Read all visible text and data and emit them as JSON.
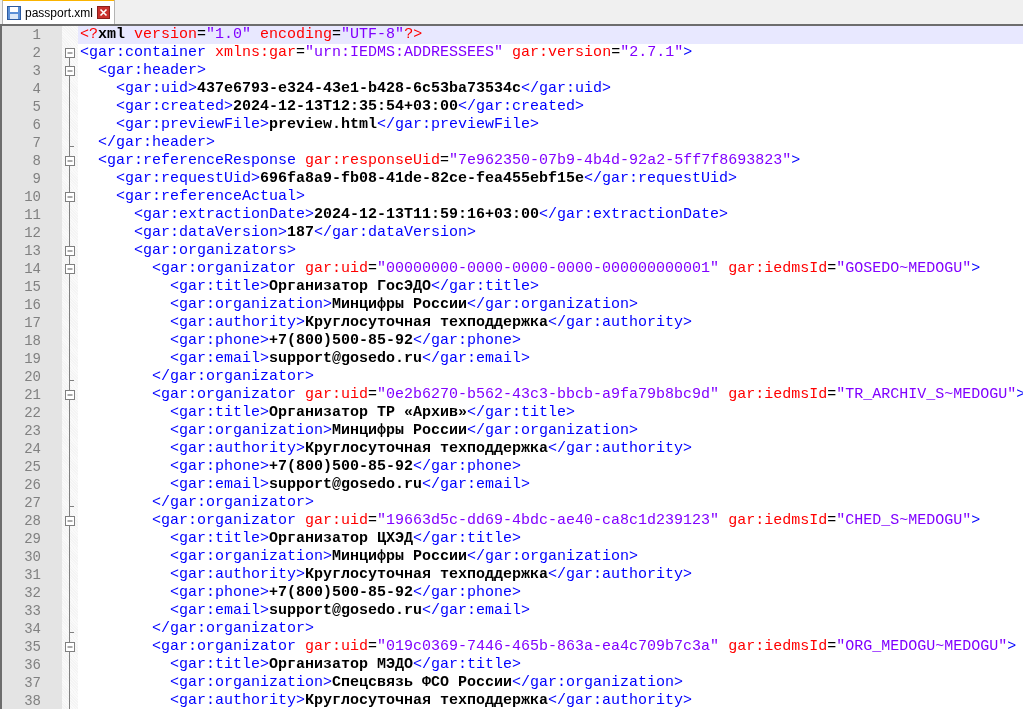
{
  "tabs": [
    {
      "label": "passport.xml",
      "selected": true
    }
  ],
  "lines": [
    {
      "number": "1",
      "kind": "plain",
      "current": true,
      "tokens": [
        {
          "kind": "pi",
          "text": "<?"
        },
        {
          "kind": "text",
          "text": "xml"
        },
        {
          "kind": "attr",
          "text": " version"
        },
        {
          "kind": "eq",
          "text": "="
        },
        {
          "kind": "value",
          "text": "\"1.0\""
        },
        {
          "kind": "attr",
          "text": " encoding"
        },
        {
          "kind": "eq",
          "text": "="
        },
        {
          "kind": "value",
          "text": "\"UTF-8\""
        },
        {
          "kind": "pi",
          "text": "?>"
        }
      ]
    },
    {
      "number": "2",
      "kind": "fold_start",
      "current": false,
      "tokens": [
        {
          "kind": "tag",
          "text": "<gar:container"
        },
        {
          "kind": "attr",
          "text": " xmlns:gar"
        },
        {
          "kind": "eq",
          "text": "="
        },
        {
          "kind": "value",
          "text": "\"urn:IEDMS:ADDRESSEES\""
        },
        {
          "kind": "attr",
          "text": " gar:version"
        },
        {
          "kind": "eq",
          "text": "="
        },
        {
          "kind": "value",
          "text": "\"2.7.1\""
        },
        {
          "kind": "tag",
          "text": ">"
        }
      ],
      "children": [
        {
          "number": "3",
          "kind": "fold_start",
          "current": false,
          "tokens": [
            {
              "kind": "tag",
              "text": "<gar:header>"
            }
          ],
          "children": [
            {
              "number": "4",
              "kind": "plain",
              "current": false,
              "tokens": [
                {
                  "kind": "tag",
                  "text": "<gar:uid>"
                },
                {
                  "kind": "text",
                  "text": "437e6793-e324-43e1-b428-6c53ba73534c"
                },
                {
                  "kind": "tag",
                  "text": "</gar:uid>"
                }
              ]
            },
            {
              "number": "5",
              "kind": "plain",
              "current": false,
              "tokens": [
                {
                  "kind": "tag",
                  "text": "<gar:created>"
                },
                {
                  "kind": "text",
                  "text": "2024-12-13T12:35:54+03:00"
                },
                {
                  "kind": "tag",
                  "text": "</gar:created>"
                }
              ]
            },
            {
              "number": "6",
              "kind": "plain",
              "current": false,
              "tokens": [
                {
                  "kind": "tag",
                  "text": "<gar:previewFile>"
                },
                {
                  "kind": "text",
                  "text": "preview.html"
                },
                {
                  "kind": "tag",
                  "text": "</gar:previewFile>"
                }
              ]
            }
          ]
        },
        {
          "number": "7",
          "kind": "fold_end",
          "current": false,
          "tokens": [
            {
              "kind": "tag",
              "text": "</gar:header>"
            }
          ]
        },
        {
          "number": "8",
          "kind": "fold_start",
          "current": false,
          "tokens": [
            {
              "kind": "tag",
              "text": "<gar:referenceResponse"
            },
            {
              "kind": "attr",
              "text": " gar:responseUid"
            },
            {
              "kind": "eq",
              "text": "="
            },
            {
              "kind": "value",
              "text": "\"7e962350-07b9-4b4d-92a2-5ff7f8693823\""
            },
            {
              "kind": "tag",
              "text": ">"
            }
          ],
          "children": [
            {
              "number": "9",
              "kind": "plain",
              "current": false,
              "tokens": [
                {
                  "kind": "tag",
                  "text": "<gar:requestUid>"
                },
                {
                  "kind": "text",
                  "text": "696fa8a9-fb08-41de-82ce-fea455ebf15e"
                },
                {
                  "kind": "tag",
                  "text": "</gar:requestUid>"
                }
              ]
            },
            {
              "number": "10",
              "kind": "fold_start",
              "current": false,
              "tokens": [
                {
                  "kind": "tag",
                  "text": "<gar:referenceActual>"
                }
              ],
              "children": [
                {
                  "number": "11",
                  "kind": "plain",
                  "current": false,
                  "tokens": [
                    {
                      "kind": "tag",
                      "text": "<gar:extractionDate>"
                    },
                    {
                      "kind": "text",
                      "text": "2024-12-13T11:59:16+03:00"
                    },
                    {
                      "kind": "tag",
                      "text": "</gar:extractionDate>"
                    }
                  ]
                },
                {
                  "number": "12",
                  "kind": "plain",
                  "current": false,
                  "tokens": [
                    {
                      "kind": "tag",
                      "text": "<gar:dataVersion>"
                    },
                    {
                      "kind": "text",
                      "text": "187"
                    },
                    {
                      "kind": "tag",
                      "text": "</gar:dataVersion>"
                    }
                  ]
                },
                {
                  "number": "13",
                  "kind": "fold_start",
                  "current": false,
                  "tokens": [
                    {
                      "kind": "tag",
                      "text": "<gar:organizators>"
                    }
                  ],
                  "children": [
                    {
                      "number": "14",
                      "kind": "fold_start",
                      "current": false,
                      "tokens": [
                        {
                          "kind": "tag",
                          "text": "<gar:organizator"
                        },
                        {
                          "kind": "attr",
                          "text": " gar:uid"
                        },
                        {
                          "kind": "eq",
                          "text": "="
                        },
                        {
                          "kind": "value",
                          "text": "\"00000000-0000-0000-0000-000000000001\""
                        },
                        {
                          "kind": "attr",
                          "text": " gar:iedmsId"
                        },
                        {
                          "kind": "eq",
                          "text": "="
                        },
                        {
                          "kind": "value",
                          "text": "\"GOSEDO~MEDOGU\""
                        },
                        {
                          "kind": "tag",
                          "text": ">"
                        }
                      ],
                      "children": [
                        {
                          "number": "15",
                          "kind": "plain",
                          "current": false,
                          "tokens": [
                            {
                              "kind": "tag",
                              "text": "<gar:title>"
                            },
                            {
                              "kind": "text",
                              "text": "Организатор ГосЭДО"
                            },
                            {
                              "kind": "tag",
                              "text": "</gar:title>"
                            }
                          ]
                        },
                        {
                          "number": "16",
                          "kind": "plain",
                          "current": false,
                          "tokens": [
                            {
                              "kind": "tag",
                              "text": "<gar:organization>"
                            },
                            {
                              "kind": "text",
                              "text": "Минцифры России"
                            },
                            {
                              "kind": "tag",
                              "text": "</gar:organization>"
                            }
                          ]
                        },
                        {
                          "number": "17",
                          "kind": "plain",
                          "current": false,
                          "tokens": [
                            {
                              "kind": "tag",
                              "text": "<gar:authority>"
                            },
                            {
                              "kind": "text",
                              "text": "Круглосуточная техподдержка"
                            },
                            {
                              "kind": "tag",
                              "text": "</gar:authority>"
                            }
                          ]
                        },
                        {
                          "number": "18",
                          "kind": "plain",
                          "current": false,
                          "tokens": [
                            {
                              "kind": "tag",
                              "text": "<gar:phone>"
                            },
                            {
                              "kind": "text",
                              "text": "+7(800)500-85-92"
                            },
                            {
                              "kind": "tag",
                              "text": "</gar:phone>"
                            }
                          ]
                        },
                        {
                          "number": "19",
                          "kind": "plain",
                          "current": false,
                          "tokens": [
                            {
                              "kind": "tag",
                              "text": "<gar:email>"
                            },
                            {
                              "kind": "text",
                              "text": "support@gosedo.ru"
                            },
                            {
                              "kind": "tag",
                              "text": "</gar:email>"
                            }
                          ]
                        }
                      ]
                    },
                    {
                      "number": "20",
                      "kind": "fold_end",
                      "current": false,
                      "tokens": [
                        {
                          "kind": "tag",
                          "text": "</gar:organizator>"
                        }
                      ]
                    },
                    {
                      "number": "21",
                      "kind": "fold_start",
                      "current": false,
                      "tokens": [
                        {
                          "kind": "tag",
                          "text": "<gar:organizator"
                        },
                        {
                          "kind": "attr",
                          "text": " gar:uid"
                        },
                        {
                          "kind": "eq",
                          "text": "="
                        },
                        {
                          "kind": "value",
                          "text": "\"0e2b6270-b562-43c3-bbcb-a9fa79b8bc9d\""
                        },
                        {
                          "kind": "attr",
                          "text": " gar:iedmsId"
                        },
                        {
                          "kind": "eq",
                          "text": "="
                        },
                        {
                          "kind": "value",
                          "text": "\"TR_ARCHIV_S~MEDOGU\""
                        },
                        {
                          "kind": "tag",
                          "text": ">"
                        }
                      ],
                      "children": [
                        {
                          "number": "22",
                          "kind": "plain",
                          "current": false,
                          "tokens": [
                            {
                              "kind": "tag",
                              "text": "<gar:title>"
                            },
                            {
                              "kind": "text",
                              "text": "Организатор ТР «Архив»"
                            },
                            {
                              "kind": "tag",
                              "text": "</gar:title>"
                            }
                          ]
                        },
                        {
                          "number": "23",
                          "kind": "plain",
                          "current": false,
                          "tokens": [
                            {
                              "kind": "tag",
                              "text": "<gar:organization>"
                            },
                            {
                              "kind": "text",
                              "text": "Минцифры России"
                            },
                            {
                              "kind": "tag",
                              "text": "</gar:organization>"
                            }
                          ]
                        },
                        {
                          "number": "24",
                          "kind": "plain",
                          "current": false,
                          "tokens": [
                            {
                              "kind": "tag",
                              "text": "<gar:authority>"
                            },
                            {
                              "kind": "text",
                              "text": "Круглосуточная техподдержка"
                            },
                            {
                              "kind": "tag",
                              "text": "</gar:authority>"
                            }
                          ]
                        },
                        {
                          "number": "25",
                          "kind": "plain",
                          "current": false,
                          "tokens": [
                            {
                              "kind": "tag",
                              "text": "<gar:phone>"
                            },
                            {
                              "kind": "text",
                              "text": "+7(800)500-85-92"
                            },
                            {
                              "kind": "tag",
                              "text": "</gar:phone>"
                            }
                          ]
                        },
                        {
                          "number": "26",
                          "kind": "plain",
                          "current": false,
                          "tokens": [
                            {
                              "kind": "tag",
                              "text": "<gar:email>"
                            },
                            {
                              "kind": "text",
                              "text": "support@gosedo.ru"
                            },
                            {
                              "kind": "tag",
                              "text": "</gar:email>"
                            }
                          ]
                        }
                      ]
                    },
                    {
                      "number": "27",
                      "kind": "fold_end",
                      "current": false,
                      "tokens": [
                        {
                          "kind": "tag",
                          "text": "</gar:organizator>"
                        }
                      ]
                    },
                    {
                      "number": "28",
                      "kind": "fold_start",
                      "current": false,
                      "tokens": [
                        {
                          "kind": "tag",
                          "text": "<gar:organizator"
                        },
                        {
                          "kind": "attr",
                          "text": " gar:uid"
                        },
                        {
                          "kind": "eq",
                          "text": "="
                        },
                        {
                          "kind": "value",
                          "text": "\"19663d5c-dd69-4bdc-ae40-ca8c1d239123\""
                        },
                        {
                          "kind": "attr",
                          "text": " gar:iedmsId"
                        },
                        {
                          "kind": "eq",
                          "text": "="
                        },
                        {
                          "kind": "value",
                          "text": "\"CHED_S~MEDOGU\""
                        },
                        {
                          "kind": "tag",
                          "text": ">"
                        }
                      ],
                      "children": [
                        {
                          "number": "29",
                          "kind": "plain",
                          "current": false,
                          "tokens": [
                            {
                              "kind": "tag",
                              "text": "<gar:title>"
                            },
                            {
                              "kind": "text",
                              "text": "Организатор ЦХЭД"
                            },
                            {
                              "kind": "tag",
                              "text": "</gar:title>"
                            }
                          ]
                        },
                        {
                          "number": "30",
                          "kind": "plain",
                          "current": false,
                          "tokens": [
                            {
                              "kind": "tag",
                              "text": "<gar:organization>"
                            },
                            {
                              "kind": "text",
                              "text": "Минцифры России"
                            },
                            {
                              "kind": "tag",
                              "text": "</gar:organization>"
                            }
                          ]
                        },
                        {
                          "number": "31",
                          "kind": "plain",
                          "current": false,
                          "tokens": [
                            {
                              "kind": "tag",
                              "text": "<gar:authority>"
                            },
                            {
                              "kind": "text",
                              "text": "Круглосуточная техподдержка"
                            },
                            {
                              "kind": "tag",
                              "text": "</gar:authority>"
                            }
                          ]
                        },
                        {
                          "number": "32",
                          "kind": "plain",
                          "current": false,
                          "tokens": [
                            {
                              "kind": "tag",
                              "text": "<gar:phone>"
                            },
                            {
                              "kind": "text",
                              "text": "+7(800)500-85-92"
                            },
                            {
                              "kind": "tag",
                              "text": "</gar:phone>"
                            }
                          ]
                        },
                        {
                          "number": "33",
                          "kind": "plain",
                          "current": false,
                          "tokens": [
                            {
                              "kind": "tag",
                              "text": "<gar:email>"
                            },
                            {
                              "kind": "text",
                              "text": "support@gosedo.ru"
                            },
                            {
                              "kind": "tag",
                              "text": "</gar:email>"
                            }
                          ]
                        }
                      ]
                    },
                    {
                      "number": "34",
                      "kind": "fold_end",
                      "current": false,
                      "tokens": [
                        {
                          "kind": "tag",
                          "text": "</gar:organizator>"
                        }
                      ]
                    },
                    {
                      "number": "35",
                      "kind": "fold_start",
                      "current": false,
                      "tokens": [
                        {
                          "kind": "tag",
                          "text": "<gar:organizator"
                        },
                        {
                          "kind": "attr",
                          "text": " gar:uid"
                        },
                        {
                          "kind": "eq",
                          "text": "="
                        },
                        {
                          "kind": "value",
                          "text": "\"019c0369-7446-465b-863a-ea4c709b7c3a\""
                        },
                        {
                          "kind": "attr",
                          "text": " gar:iedmsId"
                        },
                        {
                          "kind": "eq",
                          "text": "="
                        },
                        {
                          "kind": "value",
                          "text": "\"ORG_MEDOGU~MEDOGU\""
                        },
                        {
                          "kind": "tag",
                          "text": ">"
                        }
                      ],
                      "children": [
                        {
                          "number": "36",
                          "kind": "plain",
                          "current": false,
                          "tokens": [
                            {
                              "kind": "tag",
                              "text": "<gar:title>"
                            },
                            {
                              "kind": "text",
                              "text": "Организатор МЭДО"
                            },
                            {
                              "kind": "tag",
                              "text": "</gar:title>"
                            }
                          ]
                        },
                        {
                          "number": "37",
                          "kind": "plain",
                          "current": false,
                          "tokens": [
                            {
                              "kind": "tag",
                              "text": "<gar:organization>"
                            },
                            {
                              "kind": "text",
                              "text": "Спецсвязь ФСО России"
                            },
                            {
                              "kind": "tag",
                              "text": "</gar:organization>"
                            }
                          ]
                        },
                        {
                          "number": "38",
                          "kind": "plain",
                          "current": false,
                          "tokens": [
                            {
                              "kind": "tag",
                              "text": "<gar:authority>"
                            },
                            {
                              "kind": "text",
                              "text": "Круглосуточная техподдержка"
                            },
                            {
                              "kind": "tag",
                              "text": "</gar:authority>"
                            }
                          ]
                        }
                      ]
                    }
                  ]
                }
              ]
            }
          ]
        }
      ]
    }
  ]
}
